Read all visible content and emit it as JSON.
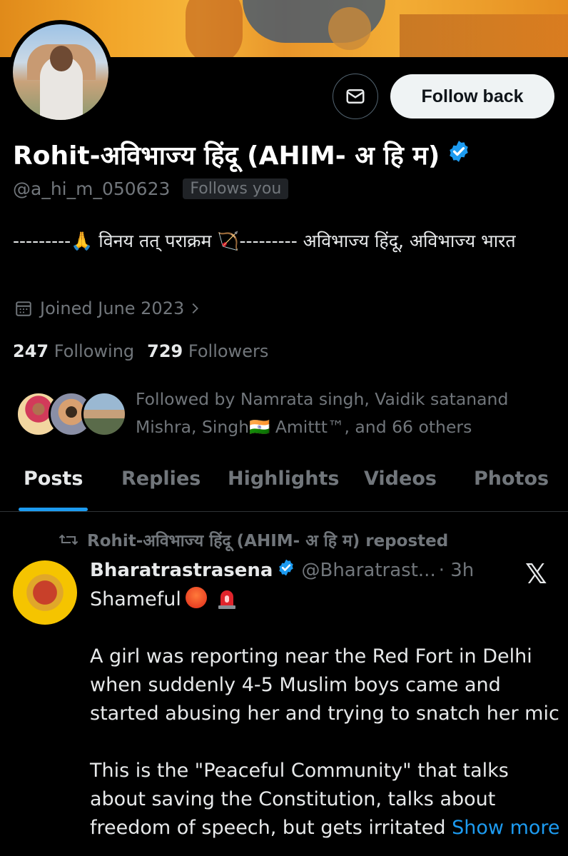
{
  "profile": {
    "name": "Rohit-अविभाज्य हिंदू (AHIM- अ हि म)",
    "handle": "@a_hi_m_050623",
    "follows_you": "Follows you",
    "bio": "---------🙏 विनय तत् पराक्रम 🏹--------- अविभाज्य हिंदू, अविभाज्य भारत",
    "joined": "Joined June 2023",
    "following_count": "247",
    "following_label": "Following",
    "followers_count": "729",
    "followers_label": "Followers",
    "followed_by": "Followed by Namrata singh, Vaidik satanand Mishra, Singh🇮🇳 Amittt™, and 66 others"
  },
  "actions": {
    "follow_back": "Follow back",
    "message_icon": "envelope-icon"
  },
  "tabs": [
    {
      "label": "Posts",
      "active": true
    },
    {
      "label": "Replies",
      "active": false
    },
    {
      "label": "Highlights",
      "active": false
    },
    {
      "label": "Videos",
      "active": false
    },
    {
      "label": "Photos",
      "active": false
    }
  ],
  "post": {
    "repost_label": "Rohit-अविभाज्य हिंदू (AHIM- अ हि म) reposted",
    "author": "Bharatrastrasena",
    "author_handle": "@Bharatrast...",
    "time": "· 3h",
    "x_logo": "𝕏",
    "line1": "Shameful",
    "para2": "A girl was reporting near the Red Fort in Delhi when suddenly 4-5 Muslim boys came and started abusing her and trying to snatch her mic",
    "para3": "This is the \"Peaceful Community\" that talks about saving the Constitution, talks about freedom of speech, but gets irritated",
    "show_more": "Show more"
  },
  "colors": {
    "background": "#000000",
    "accent": "#1d9bf0",
    "muted": "#71767b",
    "text": "#e7e9ea"
  }
}
